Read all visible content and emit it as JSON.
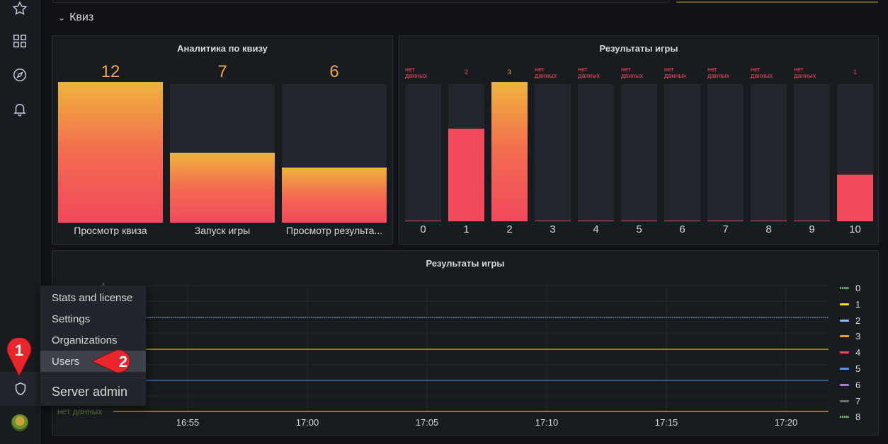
{
  "row": {
    "title": "Квиз",
    "chevron": "⌄"
  },
  "panel_analytics": {
    "title": "Аналитика по квизу",
    "gauges": [
      {
        "value": "12",
        "label": "Просмотр квиза",
        "fill": 1.0
      },
      {
        "value": "7",
        "label": "Запуск игры",
        "fill": 0.505
      },
      {
        "value": "6",
        "label": "Просмотр результа...",
        "fill": 0.4
      }
    ]
  },
  "panel_results_bars": {
    "title": "Результаты игры",
    "bars": [
      {
        "label": "0",
        "top": "нет данных",
        "value": 0
      },
      {
        "label": "1",
        "top": "2",
        "value": 2
      },
      {
        "label": "2",
        "top": "3",
        "value": 3
      },
      {
        "label": "3",
        "top": "нет данных",
        "value": 0
      },
      {
        "label": "4",
        "top": "нет данных",
        "value": 0
      },
      {
        "label": "5",
        "top": "нет данных",
        "value": 0
      },
      {
        "label": "6",
        "top": "нет данных",
        "value": 0
      },
      {
        "label": "7",
        "top": "нет данных",
        "value": 0
      },
      {
        "label": "8",
        "top": "нет данных",
        "value": 0
      },
      {
        "label": "9",
        "top": "нет данных",
        "value": 0
      },
      {
        "label": "10",
        "top": "1",
        "value": 1
      }
    ],
    "max": 3
  },
  "panel_results_timeseries": {
    "title": "Результаты игры",
    "x_ticks": [
      "16:55",
      "17:00",
      "17:05",
      "17:10",
      "17:15",
      "17:20"
    ],
    "faded_y_top": "4",
    "faded_nodata": "нет данных",
    "legend": [
      {
        "name": "0",
        "color": "#73bf69",
        "dashed": true
      },
      {
        "name": "1",
        "color": "#fade2a",
        "dashed": false
      },
      {
        "name": "2",
        "color": "#8ab8ff",
        "dashed": false
      },
      {
        "name": "3",
        "color": "#ff9830",
        "dashed": false
      },
      {
        "name": "4",
        "color": "#f2495c",
        "dashed": false
      },
      {
        "name": "5",
        "color": "#5794f2",
        "dashed": false
      },
      {
        "name": "6",
        "color": "#b877d9",
        "dashed": false
      },
      {
        "name": "7",
        "color": "#6e7177",
        "dashed": false
      },
      {
        "name": "8",
        "color": "#73bf69",
        "dashed": true
      }
    ]
  },
  "chart_data": {
    "type": "bar",
    "title": "Результаты игры",
    "categories": [
      "0",
      "1",
      "2",
      "3",
      "4",
      "5",
      "6",
      "7",
      "8",
      "9",
      "10"
    ],
    "values": [
      0,
      2,
      3,
      0,
      0,
      0,
      0,
      0,
      0,
      0,
      1
    ]
  },
  "admin_menu": {
    "items": [
      "Stats and license",
      "Settings",
      "Organizations",
      "Users"
    ],
    "active_index": 3,
    "header": "Server admin"
  },
  "annotations": {
    "pin1": "1",
    "pin2": "2"
  },
  "colors": {
    "accent_orange": "#f0a64a",
    "red": "#f2495c",
    "yellow": "#fade2a"
  }
}
